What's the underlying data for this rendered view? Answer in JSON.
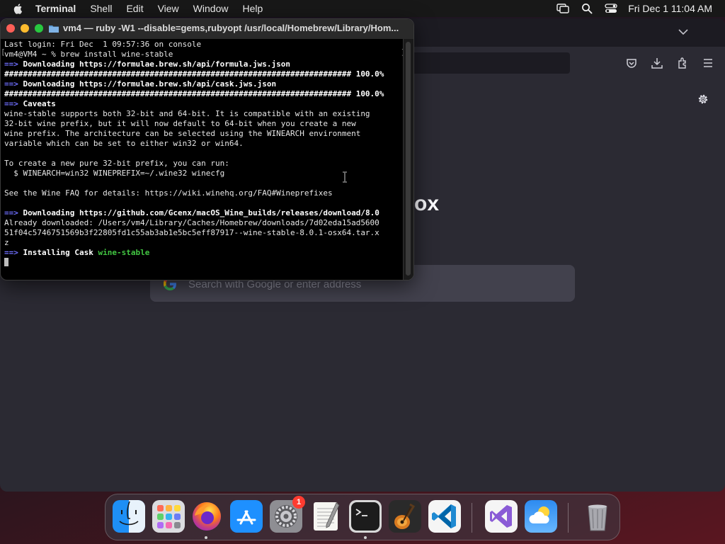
{
  "menubar": {
    "app_name": "Terminal",
    "items": [
      "Shell",
      "Edit",
      "View",
      "Window",
      "Help"
    ],
    "icons": [
      "apple-icon",
      "screen-mirroring-icon",
      "search-icon",
      "control-center-icon"
    ],
    "clock": "Fri Dec 1  11:04 AM"
  },
  "firefox": {
    "brand_fragment": "ox",
    "search_placeholder": "Search with Google or enter address",
    "icons": [
      "chevron-down-icon",
      "pocket-icon",
      "download-icon",
      "extensions-icon",
      "menu-icon",
      "gear-icon",
      "google-icon"
    ]
  },
  "terminal": {
    "title": "vm4 — ruby -W1 --disable=gems,rubyopt /usr/local/Homebrew/Library/Hom...",
    "lines": {
      "l1": "Last login: Fri Dec  1 09:57:36 on console",
      "l2": "vm4@VM4 ~ % brew install wine-stable",
      "arrow": "==>",
      "l3": " Downloading https://formulae.brew.sh/api/formula.jws.json",
      "l4": "########################################################################## 100.0%",
      "l5": " Downloading https://formulae.brew.sh/api/cask.jws.json",
      "l6": "########################################################################## 100.0%",
      "l7": " Caveats",
      "l8": "wine-stable supports both 32-bit and 64-bit. It is compatible with an existing",
      "l9": "32-bit wine prefix, but it will now default to 64-bit when you create a new",
      "l10": "wine prefix. The architecture can be selected using the WINEARCH environment",
      "l11": "variable which can be set to either win32 or win64.",
      "l12": "",
      "l13": "To create a new pure 32-bit prefix, you can run:",
      "l14": "  $ WINEARCH=win32 WINEPREFIX=~/.wine32 winecfg",
      "l15": "",
      "l16": "See the Wine FAQ for details: https://wiki.winehq.org/FAQ#Wineprefixes",
      "l17": "",
      "l18": " Downloading https://github.com/Gcenx/macOS_Wine_builds/releases/download/8.0",
      "l19": "Already downloaded: /Users/vm4/Library/Caches/Homebrew/downloads/7d02eda15ad5600",
      "l20": "51f04c5746751569b3f22805fd1c55ab3ab1e5bc5eff87917--wine-stable-8.0.1-osx64.tar.x",
      "l21": "z",
      "l22": " Installing Cask ",
      "l22_pkg": "wine-stable"
    }
  },
  "dock": {
    "items": [
      {
        "name": "finder-icon"
      },
      {
        "name": "launchpad-icon"
      },
      {
        "name": "firefox-icon"
      },
      {
        "name": "app-store-icon"
      },
      {
        "name": "system-settings-icon"
      },
      {
        "name": "textedit-icon"
      },
      {
        "name": "terminal-icon"
      },
      {
        "name": "garageband-icon"
      },
      {
        "name": "vscode-icon"
      },
      {
        "name": "visual-studio-icon"
      },
      {
        "name": "weather-icon"
      },
      {
        "name": "trash-icon"
      }
    ],
    "settings_badge": "1"
  }
}
